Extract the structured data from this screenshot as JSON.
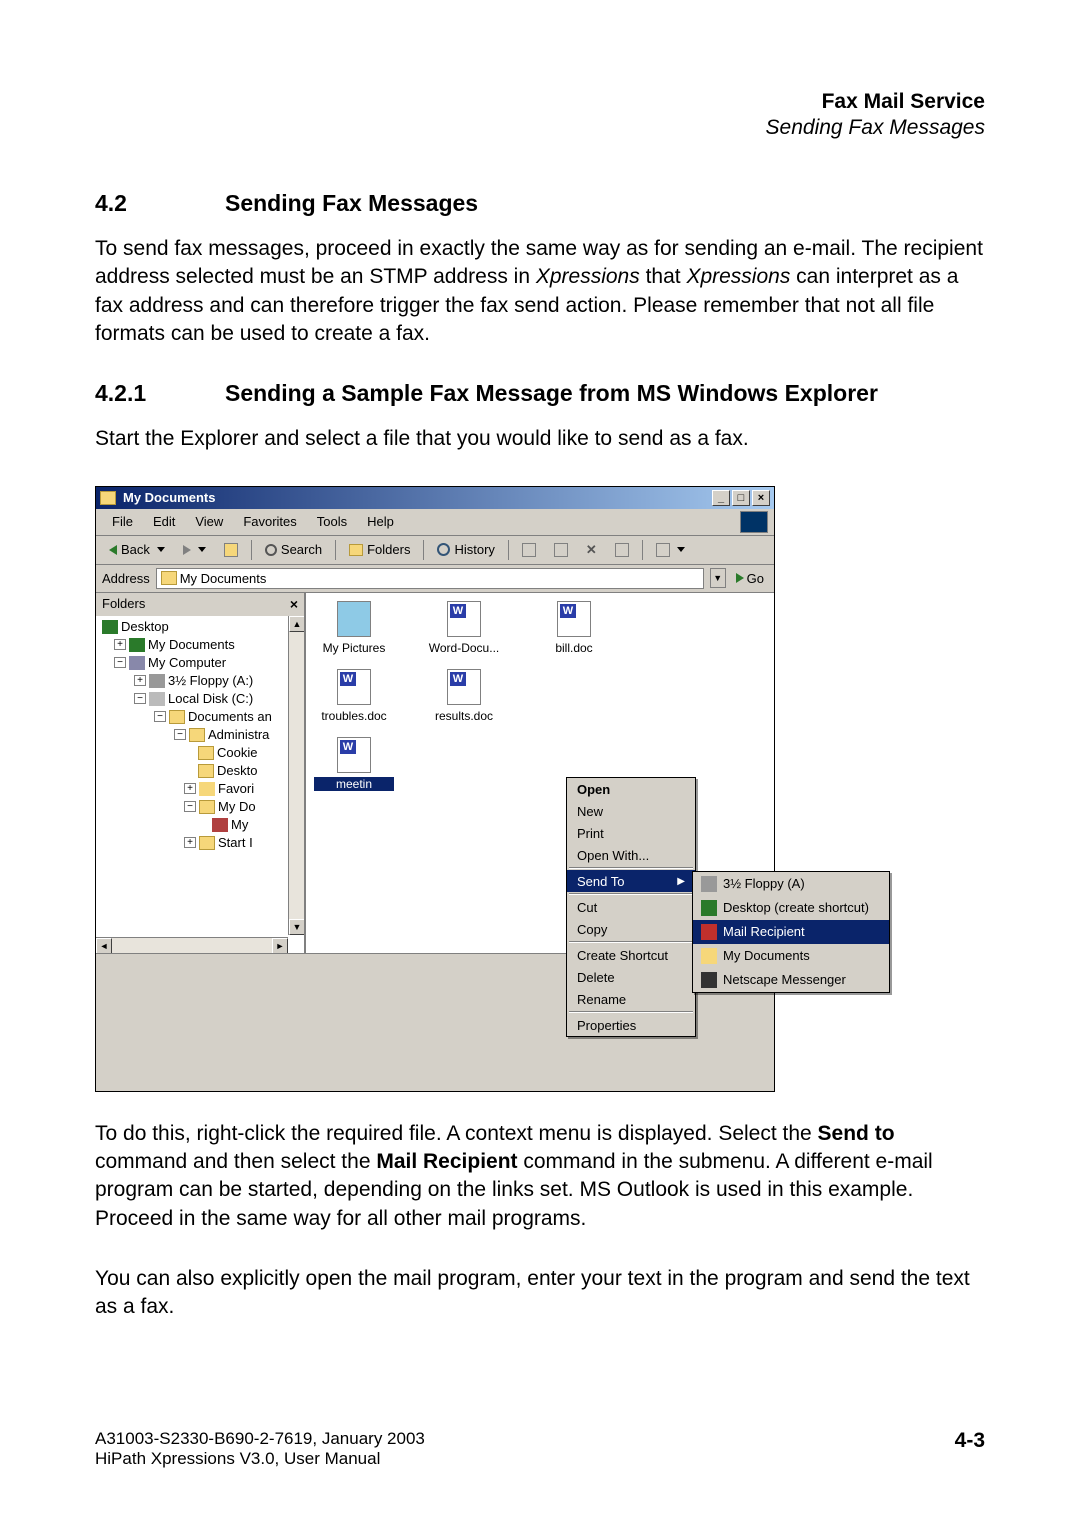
{
  "header": {
    "title": "Fax Mail Service",
    "subtitle": "Sending Fax Messages"
  },
  "section42": {
    "num": "4.2",
    "title": "Sending Fax Messages",
    "para": "To send fax messages, proceed in exactly the same way as for sending an e-mail. The recipient address selected must be an STMP address in Xpressions that Xpressions can interpret as a fax address and can therefore trigger the fax send action. Please remember that not all file formats can be used to create a fax.",
    "italic1": "Xpressions",
    "italic2": "Xpressions"
  },
  "section421": {
    "num": "4.2.1",
    "title": "Sending a Sample Fax Message from MS Windows Explorer",
    "intro": "Start the Explorer and select a file that you would like to send as a fax."
  },
  "explorer": {
    "title": "My Documents",
    "menus": [
      "File",
      "Edit",
      "View",
      "Favorites",
      "Tools",
      "Help"
    ],
    "toolbar": {
      "back": "Back",
      "search": "Search",
      "folders": "Folders",
      "history": "History"
    },
    "address": {
      "label": "Address",
      "value": "My Documents",
      "go": "Go"
    },
    "foldersPane": {
      "title": "Folders",
      "tree": {
        "desktop": "Desktop",
        "mydocs": "My Documents",
        "mycomp": "My Computer",
        "floppy": "3½ Floppy (A:)",
        "local": "Local Disk (C:)",
        "docset": "Documents an",
        "admin": "Administra",
        "cookie": "Cookie",
        "deskt": "Deskto",
        "favori": "Favori",
        "mydo": "My Do",
        "my": "My",
        "start": "Start I"
      }
    },
    "files": {
      "pictures": "My Pictures",
      "worddoc": "Word-Docu...",
      "bill": "bill.doc",
      "troubles": "troubles.doc",
      "results": "results.doc",
      "meeting": "meetin"
    },
    "context": {
      "open": "Open",
      "new": "New",
      "print": "Print",
      "openwith": "Open With...",
      "sendto": "Send To",
      "cut": "Cut",
      "copy": "Copy",
      "shortcut": "Create Shortcut",
      "delete": "Delete",
      "rename": "Rename",
      "properties": "Properties"
    },
    "submenu": {
      "floppy": "3½ Floppy (A)",
      "desktop": "Desktop (create shortcut)",
      "mail": "Mail Recipient",
      "mydocs": "My Documents",
      "netscape": "Netscape Messenger"
    }
  },
  "after": {
    "p1a": "To do this, right-click the required file. A context menu is displayed. Select the ",
    "p1b": "Send to",
    "p1c": " command and then select the ",
    "p1d": "Mail Recipient",
    "p1e": " command in the submenu. A different e-mail program can be started, depending on the links set. MS Outlook is used in this example. Proceed in the same way for all other mail programs.",
    "p2": "You can also explicitly open the mail program, enter your text in the program and send the text as a fax."
  },
  "footer": {
    "line1": "A31003-S2330-B690-2-7619, January 2003",
    "line2": "HiPath Xpressions V3.0, User Manual",
    "page": "4-3"
  }
}
